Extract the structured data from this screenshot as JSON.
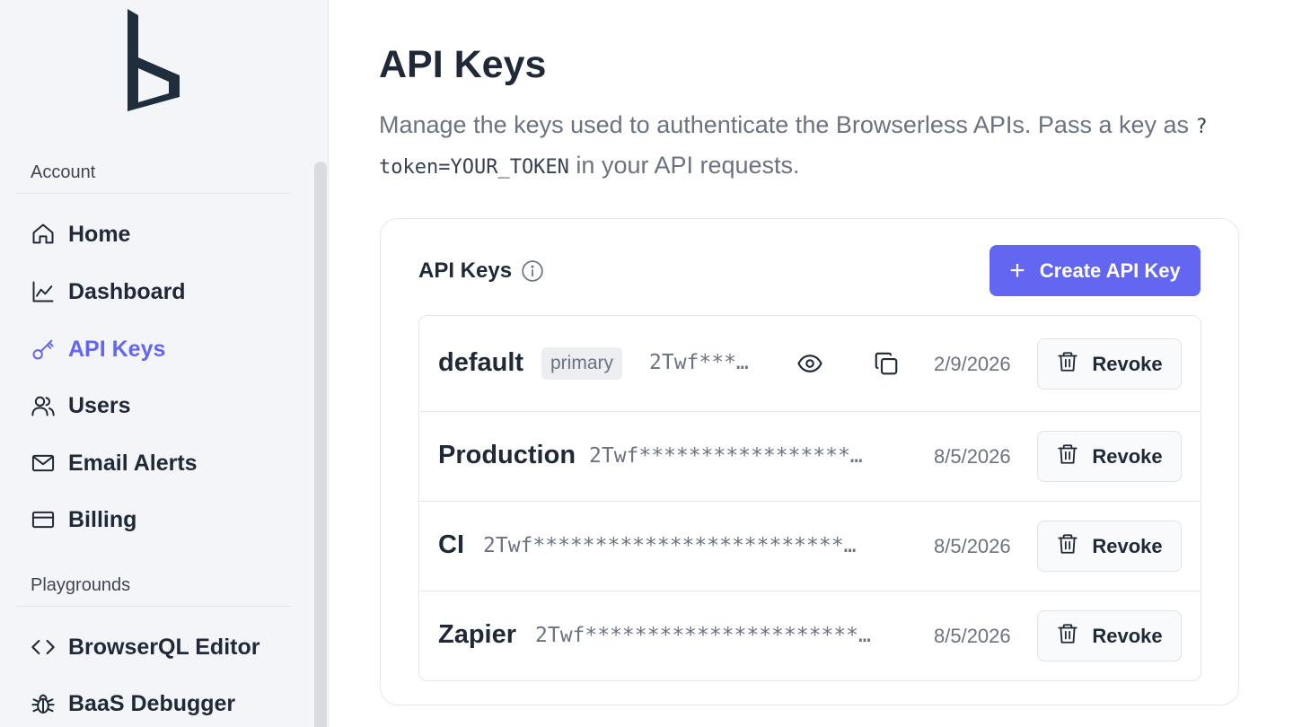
{
  "sidebar": {
    "sections": [
      {
        "label": "Account"
      },
      {
        "label": "Playgrounds"
      }
    ],
    "items": [
      {
        "label": "Home",
        "icon": "home-icon"
      },
      {
        "label": "Dashboard",
        "icon": "chart-line-icon"
      },
      {
        "label": "API Keys",
        "icon": "key-icon",
        "active": true
      },
      {
        "label": "Users",
        "icon": "users-icon"
      },
      {
        "label": "Email Alerts",
        "icon": "mail-icon"
      },
      {
        "label": "Billing",
        "icon": "credit-card-icon"
      },
      {
        "label": "BrowserQL Editor",
        "icon": "code-icon"
      },
      {
        "label": "BaaS Debugger",
        "icon": "bug-icon"
      }
    ]
  },
  "main": {
    "title": "API Keys",
    "description_before": "Manage the keys used to authenticate the Browserless APIs. Pass a key as ",
    "description_code": "?token=YOUR_TOKEN",
    "description_after": " in your API requests."
  },
  "card": {
    "title": "API Keys",
    "create_button_label": "Create API Key",
    "keys": [
      {
        "name": "default",
        "badge": "primary",
        "token": "2Twf***…",
        "date": "2/9/2026",
        "revoke_label": "Revoke"
      },
      {
        "name": "Production",
        "token": "2Twf*****************…",
        "date": "8/5/2026",
        "revoke_label": "Revoke"
      },
      {
        "name": "CI",
        "token": "2Twf*************************…",
        "date": "8/5/2026",
        "revoke_label": "Revoke"
      },
      {
        "name": "Zapier",
        "token": "2Twf**********************…",
        "date": "8/5/2026",
        "revoke_label": "Revoke"
      }
    ]
  },
  "colors": {
    "accent": "#6366f1",
    "sidebar_bg": "#f3f5f8",
    "text": "#1f2937",
    "muted": "#6b7280"
  }
}
